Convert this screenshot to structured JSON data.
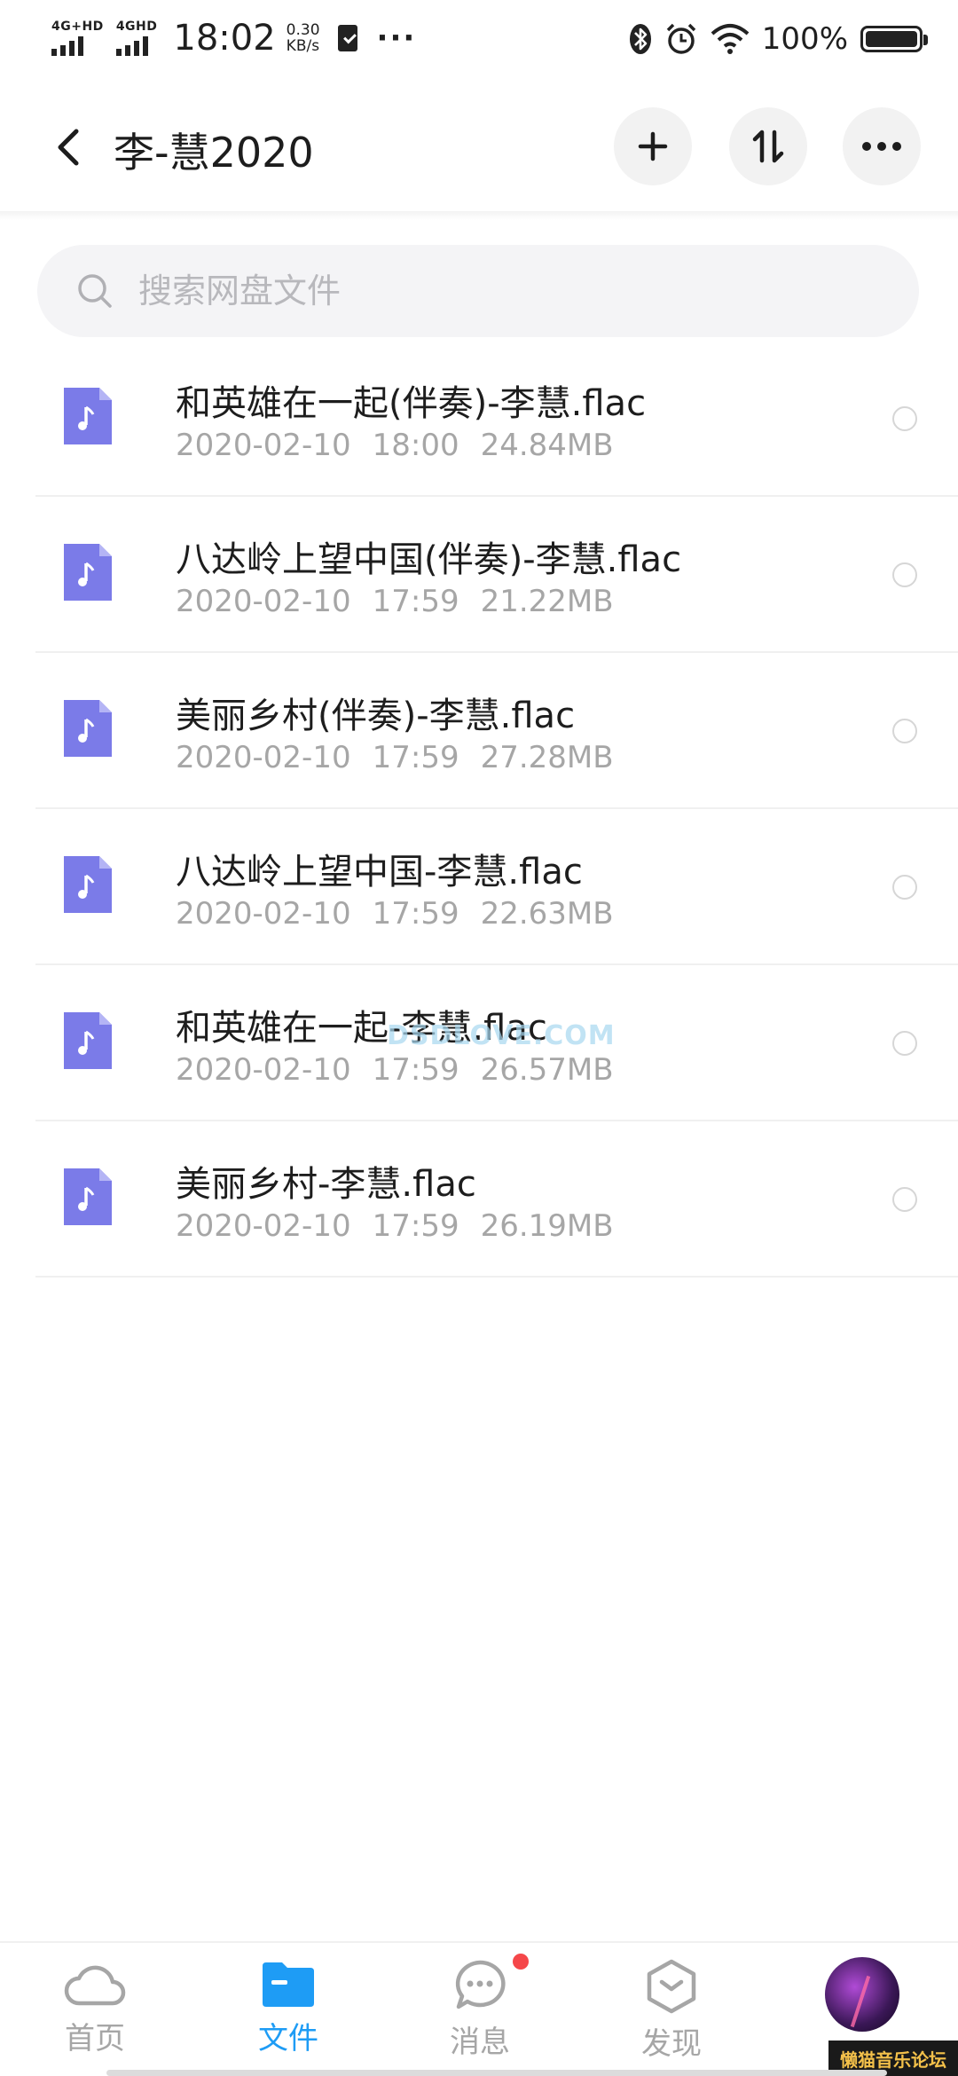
{
  "status_bar": {
    "network1": "4G+HD",
    "network2": "4GHD",
    "time": "18:02",
    "speed_value": "0.30",
    "speed_unit": "KB/s",
    "more": "···",
    "battery_percent": "100%",
    "icons": [
      "bluetooth-icon",
      "alarm-icon",
      "wifi-icon",
      "battery-icon"
    ]
  },
  "header": {
    "title": "李-慧2020",
    "actions": [
      "add-icon",
      "sort-icon",
      "more-icon"
    ]
  },
  "search": {
    "placeholder": "搜索网盘文件"
  },
  "files": [
    {
      "name": "和英雄在一起(伴奏)-李慧.flac",
      "date": "2020-02-10",
      "time": "18:00",
      "size": "24.84MB"
    },
    {
      "name": "八达岭上望中国(伴奏)-李慧.flac",
      "date": "2020-02-10",
      "time": "17:59",
      "size": "21.22MB"
    },
    {
      "name": "美丽乡村(伴奏)-李慧.flac",
      "date": "2020-02-10",
      "time": "17:59",
      "size": "27.28MB"
    },
    {
      "name": "八达岭上望中国-李慧.flac",
      "date": "2020-02-10",
      "time": "17:59",
      "size": "22.63MB"
    },
    {
      "name": "和英雄在一起-李慧.flac",
      "date": "2020-02-10",
      "time": "17:59",
      "size": "26.57MB"
    },
    {
      "name": "美丽乡村-李慧.flac",
      "date": "2020-02-10",
      "time": "17:59",
      "size": "26.19MB"
    }
  ],
  "watermark": "DSDLOVE.COM",
  "tabs": [
    {
      "label": "首页",
      "icon": "cloud-icon",
      "active": false
    },
    {
      "label": "文件",
      "icon": "folder-icon",
      "active": true
    },
    {
      "label": "消息",
      "icon": "chat-icon",
      "active": false
    },
    {
      "label": "发现",
      "icon": "discover-icon",
      "active": false
    }
  ],
  "forum_tag": "懒猫音乐论坛",
  "colors": {
    "accent": "#1e9cf5",
    "file_icon": "#7b7be8",
    "badge": "#f5474a"
  }
}
